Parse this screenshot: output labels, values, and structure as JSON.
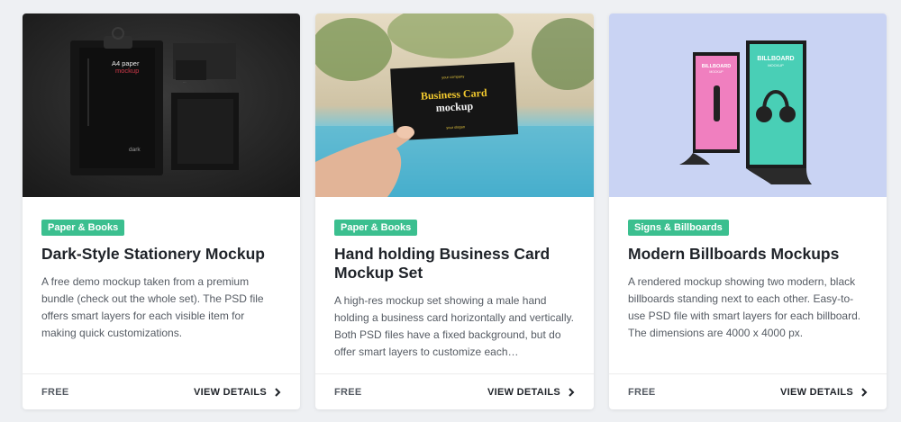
{
  "cards": [
    {
      "category": "Paper & Books",
      "title": "Dark-Style Stationery Mockup",
      "description": "A free demo mockup taken from a premium bundle (check out the whole set). The PSD file offers smart layers for each visible item for making quick customizations.",
      "price": "FREE",
      "cta": "VIEW DETAILS",
      "image_text": {
        "line1": "A4 paper",
        "line2": "mockup",
        "brand": "dark"
      }
    },
    {
      "category": "Paper & Books",
      "title": "Hand holding Business Card Mockup Set",
      "description": "A high-res mockup set showing a male hand holding a business card horizontally and vertically. Both PSD files have a fixed background, but do offer smart layers to customize each…",
      "price": "FREE",
      "cta": "VIEW DETAILS",
      "image_text": {
        "top": "your company",
        "line1": "Business Card",
        "line2": "mockup",
        "bottom": "your slogan"
      }
    },
    {
      "category": "Signs & Billboards",
      "title": "Modern Billboards Mockups",
      "description": "A rendered mockup showing two modern, black billboards standing next to each other. Easy-to-use PSD file with smart layers for each billboard. The dimensions are 4000 x 4000 px.",
      "price": "FREE",
      "cta": "VIEW DETAILS",
      "image_text": {
        "line1": "BILLBOARD",
        "line2": "MOCKUP"
      }
    }
  ],
  "colors": {
    "badge": "#3bbf8f",
    "page_bg": "#eef0f3",
    "title": "#1f2329",
    "body_text": "#555b63"
  }
}
